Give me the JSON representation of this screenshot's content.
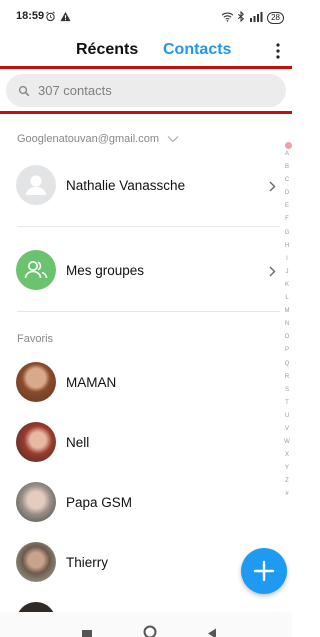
{
  "status_bar": {
    "time": "18:59",
    "battery": "28",
    "icons": [
      "alarm-icon",
      "warning-icon",
      "wifi-icon",
      "bluetooth-icon",
      "signal-icon",
      "battery-icon"
    ]
  },
  "header": {
    "tabs": [
      {
        "label": "Récents",
        "active": false
      },
      {
        "label": "Contacts",
        "active": true
      }
    ],
    "accent_color": "#2196f3",
    "highlight_color": "#c21010"
  },
  "search": {
    "placeholder": "307 contacts"
  },
  "account": {
    "email": "Googlenatouvan@gmail.com"
  },
  "top_items": [
    {
      "name": "Nathalie Vanassche",
      "icon": "person-icon"
    },
    {
      "name": "Mes groupes",
      "icon": "group-icon"
    }
  ],
  "favorites": {
    "label": "Favoris",
    "items": [
      {
        "name": "MAMAN"
      },
      {
        "name": "Nell"
      },
      {
        "name": "Papa GSM"
      },
      {
        "name": "Thierry"
      }
    ]
  },
  "alpha_index": [
    "A",
    "B",
    "C",
    "D",
    "E",
    "F",
    "G",
    "H",
    "I",
    "J",
    "K",
    "L",
    "M",
    "N",
    "O",
    "P",
    "Q",
    "R",
    "S",
    "T",
    "U",
    "V",
    "W",
    "X",
    "Y",
    "Z",
    "#"
  ],
  "fab": {
    "icon": "plus-icon",
    "color": "#1e9bf0"
  },
  "nav": {
    "icons": [
      "recent-apps-icon",
      "home-icon",
      "back-icon"
    ]
  }
}
